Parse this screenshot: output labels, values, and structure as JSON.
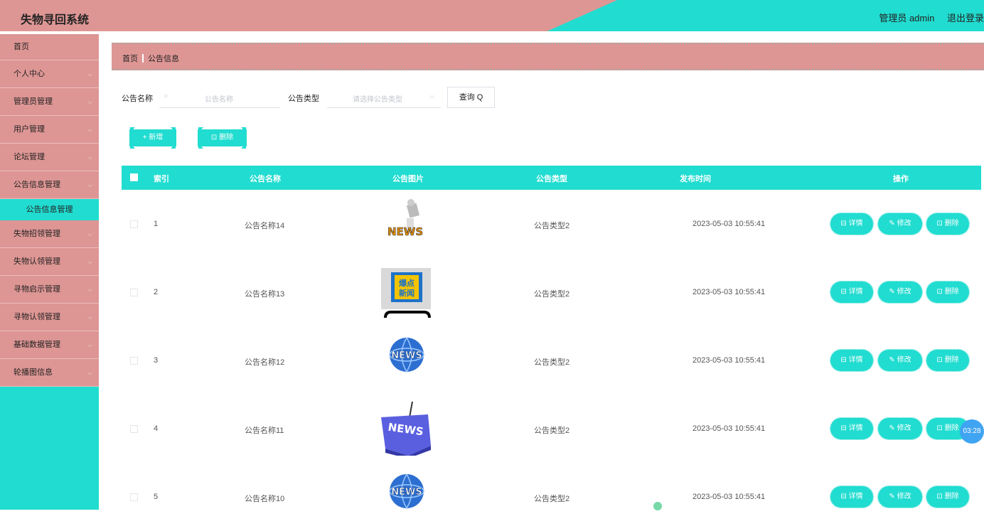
{
  "header": {
    "title": "失物寻回系统",
    "user": "管理员 admin",
    "logout": "退出登录"
  },
  "sidebar": {
    "items": [
      {
        "label": "首页",
        "expandable": false
      },
      {
        "label": "个人中心",
        "expandable": true
      },
      {
        "label": "管理员管理",
        "expandable": true
      },
      {
        "label": "用户管理",
        "expandable": true
      },
      {
        "label": "论坛管理",
        "expandable": true
      },
      {
        "label": "公告信息管理",
        "expandable": true
      },
      {
        "label": "失物招领管理",
        "expandable": true
      },
      {
        "label": "失物认领管理",
        "expandable": true
      },
      {
        "label": "寻物启示管理",
        "expandable": true
      },
      {
        "label": "寻物认领管理",
        "expandable": true
      },
      {
        "label": "基础数据管理",
        "expandable": true
      },
      {
        "label": "轮播图信息",
        "expandable": true
      }
    ],
    "submenu": {
      "label": "公告信息管理"
    },
    "chevron": "⌵"
  },
  "breadcrumb": {
    "home": "首页",
    "current": "公告信息"
  },
  "search": {
    "name_label": "公告名称",
    "name_placeholder": "公告名称",
    "type_label": "公告类型",
    "type_placeholder": "请选择公告类型",
    "query_label": "查询",
    "query_icon": "Q"
  },
  "actions": {
    "add_label": "+ 新增",
    "delete_label": "⊡ 删除"
  },
  "table": {
    "columns": [
      "索引",
      "公告名称",
      "公告图片",
      "公告类型",
      "发布时间",
      "操作"
    ],
    "rows": [
      {
        "index": "1",
        "name": "公告名称14",
        "image": "news-figure",
        "type": "公告类型2",
        "time": "2023-05-03 10:55:41"
      },
      {
        "index": "2",
        "name": "公告名称13",
        "image": "breaking-news-phone",
        "type": "公告类型2",
        "time": "2023-05-03 10:55:41"
      },
      {
        "index": "3",
        "name": "公告名称12",
        "image": "news-globe",
        "type": "公告类型2",
        "time": "2023-05-03 10:55:41"
      },
      {
        "index": "4",
        "name": "公告名称11",
        "image": "news-key",
        "type": "公告类型2",
        "time": "2023-05-03 10:55:41"
      },
      {
        "index": "5",
        "name": "公告名称10",
        "image": "news-globe",
        "type": "公告类型2",
        "time": "2023-05-03 10:55:41"
      }
    ],
    "op_labels": {
      "detail": "⊟ 详情",
      "edit": "✎ 修改",
      "delete": "⊡ 删除"
    }
  },
  "timer": "03:28",
  "colors": {
    "pink": "#dd9694",
    "teal": "#21dcd0"
  }
}
